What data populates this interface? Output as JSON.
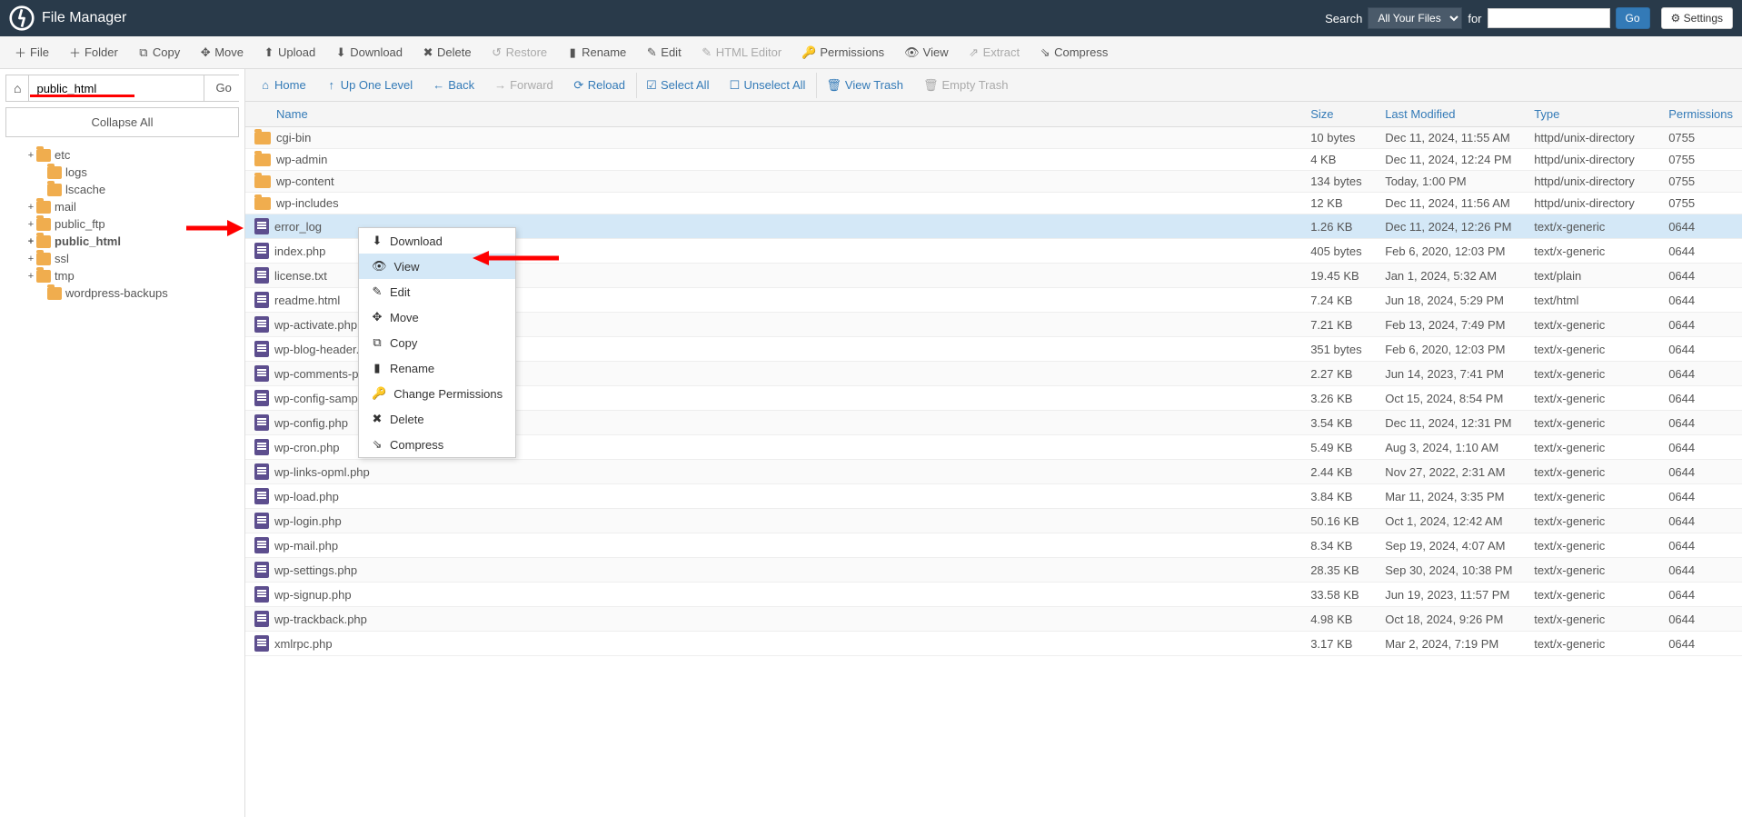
{
  "header": {
    "title": "File Manager",
    "search_label": "Search",
    "search_scope": "All Your Files",
    "for_label": "for",
    "go_label": "Go",
    "settings_label": "Settings"
  },
  "toolbar": [
    {
      "icon": "＋",
      "label": "File",
      "disabled": false
    },
    {
      "icon": "＋",
      "label": "Folder",
      "disabled": false
    },
    {
      "icon": "⧉",
      "label": "Copy",
      "disabled": false
    },
    {
      "icon": "✥",
      "label": "Move",
      "disabled": false
    },
    {
      "icon": "⬆",
      "label": "Upload",
      "disabled": false
    },
    {
      "icon": "⬇",
      "label": "Download",
      "disabled": false
    },
    {
      "icon": "✖",
      "label": "Delete",
      "disabled": false
    },
    {
      "icon": "↺",
      "label": "Restore",
      "disabled": true
    },
    {
      "icon": "▮",
      "label": "Rename",
      "disabled": false
    },
    {
      "icon": "✎",
      "label": "Edit",
      "disabled": false
    },
    {
      "icon": "✎",
      "label": "HTML Editor",
      "disabled": true
    },
    {
      "icon": "🔑",
      "label": "Permissions",
      "disabled": false
    },
    {
      "icon": "👁",
      "label": "View",
      "disabled": false
    },
    {
      "icon": "⇗",
      "label": "Extract",
      "disabled": true
    },
    {
      "icon": "⇘",
      "label": "Compress",
      "disabled": false
    }
  ],
  "sidebar": {
    "path": "public_html",
    "go_label": "Go",
    "collapse_label": "Collapse All",
    "tree": [
      {
        "label": "etc",
        "indent": 28,
        "expand": "+",
        "bold": false
      },
      {
        "label": "logs",
        "indent": 40,
        "expand": "",
        "bold": false
      },
      {
        "label": "lscache",
        "indent": 40,
        "expand": "",
        "bold": false
      },
      {
        "label": "mail",
        "indent": 28,
        "expand": "+",
        "bold": false
      },
      {
        "label": "public_ftp",
        "indent": 28,
        "expand": "+",
        "bold": false
      },
      {
        "label": "public_html",
        "indent": 28,
        "expand": "+",
        "bold": true
      },
      {
        "label": "ssl",
        "indent": 28,
        "expand": "+",
        "bold": false
      },
      {
        "label": "tmp",
        "indent": 28,
        "expand": "+",
        "bold": false
      },
      {
        "label": "wordpress-backups",
        "indent": 40,
        "expand": "",
        "bold": false
      }
    ]
  },
  "nav": [
    {
      "icon": "⌂",
      "label": "Home",
      "disabled": false,
      "sep": false
    },
    {
      "icon": "↑",
      "label": "Up One Level",
      "disabled": false,
      "sep": false
    },
    {
      "icon": "←",
      "label": "Back",
      "disabled": false,
      "sep": false
    },
    {
      "icon": "→",
      "label": "Forward",
      "disabled": true,
      "sep": false
    },
    {
      "icon": "⟳",
      "label": "Reload",
      "disabled": false,
      "sep": false
    },
    {
      "icon": "☑",
      "label": "Select All",
      "disabled": false,
      "sep": true
    },
    {
      "icon": "☐",
      "label": "Unselect All",
      "disabled": false,
      "sep": false
    },
    {
      "icon": "🗑",
      "label": "View Trash",
      "disabled": false,
      "sep": true
    },
    {
      "icon": "🗑",
      "label": "Empty Trash",
      "disabled": true,
      "sep": false
    }
  ],
  "columns": {
    "name": "Name",
    "size": "Size",
    "modified": "Last Modified",
    "type": "Type",
    "permissions": "Permissions"
  },
  "files": [
    {
      "icon": "folder",
      "name": "cgi-bin",
      "size": "10 bytes",
      "modified": "Dec 11, 2024, 11:55 AM",
      "type": "httpd/unix-directory",
      "perm": "0755",
      "selected": false
    },
    {
      "icon": "folder",
      "name": "wp-admin",
      "size": "4 KB",
      "modified": "Dec 11, 2024, 12:24 PM",
      "type": "httpd/unix-directory",
      "perm": "0755",
      "selected": false
    },
    {
      "icon": "folder",
      "name": "wp-content",
      "size": "134 bytes",
      "modified": "Today, 1:00 PM",
      "type": "httpd/unix-directory",
      "perm": "0755",
      "selected": false
    },
    {
      "icon": "folder",
      "name": "wp-includes",
      "size": "12 KB",
      "modified": "Dec 11, 2024, 11:56 AM",
      "type": "httpd/unix-directory",
      "perm": "0755",
      "selected": false
    },
    {
      "icon": "file",
      "name": "error_log",
      "size": "1.26 KB",
      "modified": "Dec 11, 2024, 12:26 PM",
      "type": "text/x-generic",
      "perm": "0644",
      "selected": true
    },
    {
      "icon": "file",
      "name": "index.php",
      "size": "405 bytes",
      "modified": "Feb 6, 2020, 12:03 PM",
      "type": "text/x-generic",
      "perm": "0644",
      "selected": false
    },
    {
      "icon": "file",
      "name": "license.txt",
      "size": "19.45 KB",
      "modified": "Jan 1, 2024, 5:32 AM",
      "type": "text/plain",
      "perm": "0644",
      "selected": false
    },
    {
      "icon": "file",
      "name": "readme.html",
      "size": "7.24 KB",
      "modified": "Jun 18, 2024, 5:29 PM",
      "type": "text/html",
      "perm": "0644",
      "selected": false
    },
    {
      "icon": "file",
      "name": "wp-activate.php",
      "size": "7.21 KB",
      "modified": "Feb 13, 2024, 7:49 PM",
      "type": "text/x-generic",
      "perm": "0644",
      "selected": false
    },
    {
      "icon": "file",
      "name": "wp-blog-header.p",
      "size": "351 bytes",
      "modified": "Feb 6, 2020, 12:03 PM",
      "type": "text/x-generic",
      "perm": "0644",
      "selected": false
    },
    {
      "icon": "file",
      "name": "wp-comments-po",
      "size": "2.27 KB",
      "modified": "Jun 14, 2023, 7:41 PM",
      "type": "text/x-generic",
      "perm": "0644",
      "selected": false
    },
    {
      "icon": "file",
      "name": "wp-config-sample",
      "size": "3.26 KB",
      "modified": "Oct 15, 2024, 8:54 PM",
      "type": "text/x-generic",
      "perm": "0644",
      "selected": false
    },
    {
      "icon": "file",
      "name": "wp-config.php",
      "size": "3.54 KB",
      "modified": "Dec 11, 2024, 12:31 PM",
      "type": "text/x-generic",
      "perm": "0644",
      "selected": false
    },
    {
      "icon": "file",
      "name": "wp-cron.php",
      "size": "5.49 KB",
      "modified": "Aug 3, 2024, 1:10 AM",
      "type": "text/x-generic",
      "perm": "0644",
      "selected": false
    },
    {
      "icon": "file",
      "name": "wp-links-opml.php",
      "size": "2.44 KB",
      "modified": "Nov 27, 2022, 2:31 AM",
      "type": "text/x-generic",
      "perm": "0644",
      "selected": false
    },
    {
      "icon": "file",
      "name": "wp-load.php",
      "size": "3.84 KB",
      "modified": "Mar 11, 2024, 3:35 PM",
      "type": "text/x-generic",
      "perm": "0644",
      "selected": false
    },
    {
      "icon": "file",
      "name": "wp-login.php",
      "size": "50.16 KB",
      "modified": "Oct 1, 2024, 12:42 AM",
      "type": "text/x-generic",
      "perm": "0644",
      "selected": false
    },
    {
      "icon": "file",
      "name": "wp-mail.php",
      "size": "8.34 KB",
      "modified": "Sep 19, 2024, 4:07 AM",
      "type": "text/x-generic",
      "perm": "0644",
      "selected": false
    },
    {
      "icon": "file",
      "name": "wp-settings.php",
      "size": "28.35 KB",
      "modified": "Sep 30, 2024, 10:38 PM",
      "type": "text/x-generic",
      "perm": "0644",
      "selected": false
    },
    {
      "icon": "file",
      "name": "wp-signup.php",
      "size": "33.58 KB",
      "modified": "Jun 19, 2023, 11:57 PM",
      "type": "text/x-generic",
      "perm": "0644",
      "selected": false
    },
    {
      "icon": "file",
      "name": "wp-trackback.php",
      "size": "4.98 KB",
      "modified": "Oct 18, 2024, 9:26 PM",
      "type": "text/x-generic",
      "perm": "0644",
      "selected": false
    },
    {
      "icon": "file",
      "name": "xmlrpc.php",
      "size": "3.17 KB",
      "modified": "Mar 2, 2024, 7:19 PM",
      "type": "text/x-generic",
      "perm": "0644",
      "selected": false
    }
  ],
  "context_menu": [
    {
      "icon": "⬇",
      "label": "Download",
      "highlight": false
    },
    {
      "icon": "👁",
      "label": "View",
      "highlight": true
    },
    {
      "icon": "✎",
      "label": "Edit",
      "highlight": false
    },
    {
      "icon": "✥",
      "label": "Move",
      "highlight": false
    },
    {
      "icon": "⧉",
      "label": "Copy",
      "highlight": false
    },
    {
      "icon": "▮",
      "label": "Rename",
      "highlight": false
    },
    {
      "icon": "🔑",
      "label": "Change Permissions",
      "highlight": false
    },
    {
      "icon": "✖",
      "label": "Delete",
      "highlight": false
    },
    {
      "icon": "⇘",
      "label": "Compress",
      "highlight": false
    }
  ]
}
